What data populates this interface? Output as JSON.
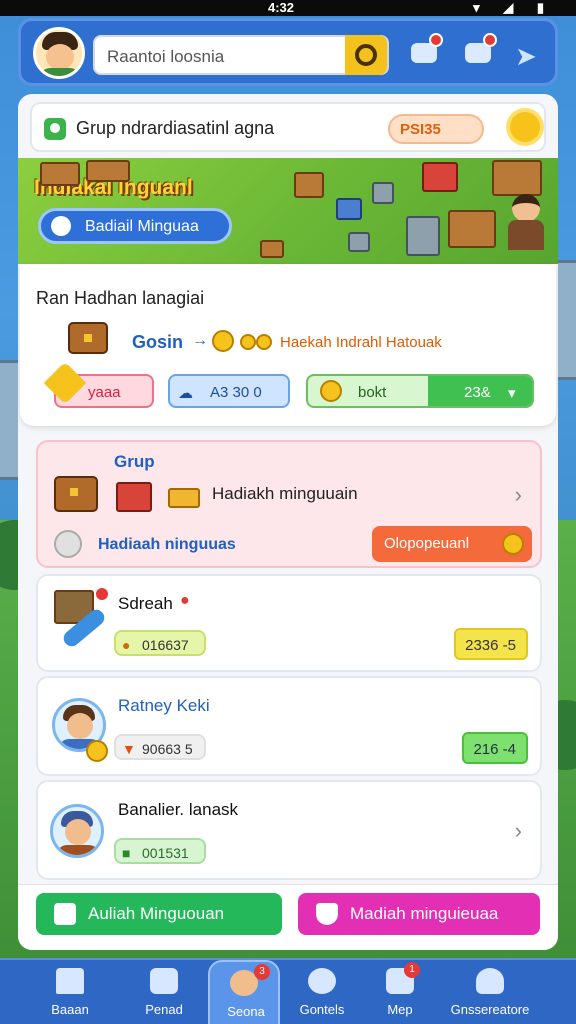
{
  "status_bar": {
    "time": "4:32"
  },
  "header": {
    "search_value": "Raantoi loosnia"
  },
  "group_header": {
    "title": "Grup ndrardiasatinl agna",
    "badge": "PSI35"
  },
  "banner": {
    "title": "Indiakal Inguanl",
    "button_label": "Badiail Minguaa"
  },
  "info_card": {
    "title": "Ran Hadhan lanagiai",
    "flow_source": "Gosin",
    "flow_text": "Haekah Indrahl Hatouak",
    "pill_pink": "yaaa",
    "pill_blue": "A3 30 0",
    "pill_green_left": "bokt",
    "pill_green_right": "23&"
  },
  "group_card": {
    "title": "Grup",
    "reward": "Hadiakh minguuain",
    "sub": "Hadiaah ninguuas",
    "button": "Olopopeuanl"
  },
  "list": [
    {
      "title": "Sdreah",
      "stat": "016637",
      "score": "2336 -5",
      "score_color": "#f5e34a",
      "stat_color": "#e6f6a8"
    },
    {
      "title": "Ratney Keki",
      "stat": "90663 5",
      "score": "216 -4",
      "score_color": "#7ee06e",
      "stat_color": "#f0f0f0"
    },
    {
      "title": "Banalier. lanask",
      "stat": "001531",
      "score": "",
      "score_color": "",
      "stat_color": "#d8f5d2"
    }
  ],
  "actions": {
    "left": "Auliah Minguouan",
    "right": "Madiah minguieuaa"
  },
  "nav": [
    {
      "label": "Baaan",
      "icon": "home-icon",
      "badge": ""
    },
    {
      "label": "Penad",
      "icon": "shop-icon",
      "badge": ""
    },
    {
      "label": "Seona",
      "icon": "character-icon",
      "badge": "3"
    },
    {
      "label": "Gontels",
      "icon": "gear-icon",
      "badge": ""
    },
    {
      "label": "Mep",
      "icon": "map-icon",
      "badge": "1"
    },
    {
      "label": "Gnssereatore",
      "icon": "profile-icon",
      "badge": ""
    }
  ],
  "colors": {
    "primary_blue": "#2f6fcf",
    "accent_orange": "#f46a3a",
    "accent_green": "#25b85a",
    "accent_magenta": "#e22fb4"
  }
}
